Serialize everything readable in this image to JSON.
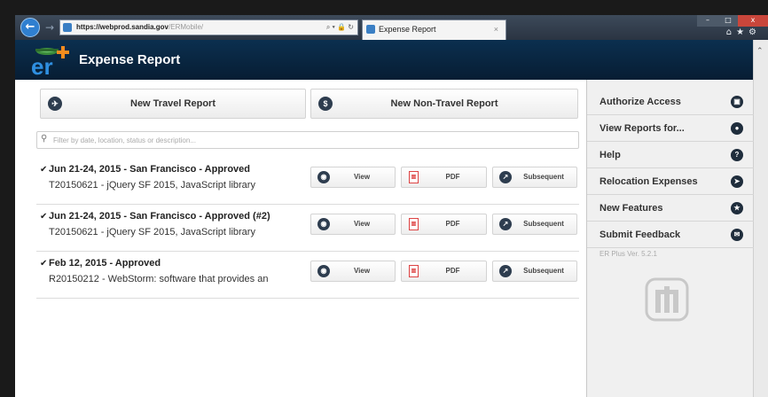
{
  "browser": {
    "url_host": "https://webprod.sandia.gov",
    "url_path": "/ERMobile/",
    "tab_title": "Expense Report",
    "address_tools": "⌕ ▾ 🔒 ↻",
    "tab_close": "×",
    "window_buttons": {
      "min": "–",
      "max": "□",
      "close": "x"
    },
    "icons": [
      "home-icon",
      "favorites-icon",
      "settings-icon"
    ]
  },
  "header": {
    "title": "Expense Report"
  },
  "main": {
    "new_travel_label": "New Travel Report",
    "new_nontravel_label": "New Non-Travel Report",
    "filter_placeholder": "Filter by date, location, status or description...",
    "reports": [
      {
        "title": "Jun 21-24, 2015 - San Francisco - Approved",
        "description": "T20150621 - jQuery SF 2015, JavaScript library",
        "view_label": "View",
        "pdf_label": "PDF",
        "subsequent_label": "Subsequent"
      },
      {
        "title": "Jun 21-24, 2015 - San Francisco - Approved (#2)",
        "description": "T20150621 - jQuery SF 2015, JavaScript library",
        "view_label": "View",
        "pdf_label": "PDF",
        "subsequent_label": "Subsequent"
      },
      {
        "title": "Feb 12, 2015 - Approved",
        "description": "R20150212 - WebStorm: software that provides an",
        "view_label": "View",
        "pdf_label": "PDF",
        "subsequent_label": "Subsequent"
      }
    ]
  },
  "sidebar": {
    "items": [
      {
        "label": "Authorize Access",
        "icon": "lock-icon"
      },
      {
        "label": "View Reports for...",
        "icon": "user-icon"
      },
      {
        "label": "Help",
        "icon": "question-icon"
      },
      {
        "label": "Relocation Expenses",
        "icon": "arrow-right-icon"
      },
      {
        "label": "New Features",
        "icon": "star-icon"
      },
      {
        "label": "Submit Feedback",
        "icon": "mail-icon"
      }
    ],
    "version": "ER Plus Ver. 5.2.1"
  },
  "colors": {
    "header_bg": "#0b2f4f",
    "icon_dark": "#2e3d4f",
    "sidebar_bg": "#f0f0f0"
  }
}
